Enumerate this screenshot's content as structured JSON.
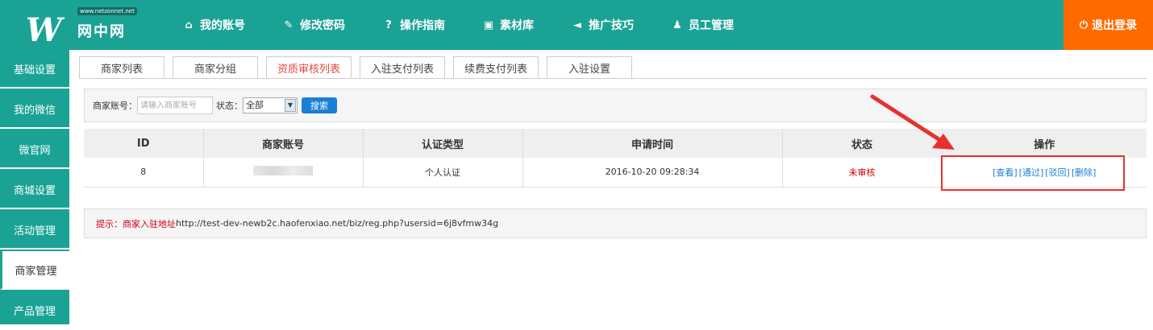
{
  "logo": {
    "url_badge": "www.netzonnet.net",
    "text": "网中网",
    "mark": "W"
  },
  "topnav": [
    {
      "label": "我的账号",
      "icon": "home-icon",
      "glyph": "⌂"
    },
    {
      "label": "修改密码",
      "icon": "edit-icon",
      "glyph": "✎"
    },
    {
      "label": "操作指南",
      "icon": "help-icon",
      "glyph": "?"
    },
    {
      "label": "素材库",
      "icon": "image-icon",
      "glyph": "▣"
    },
    {
      "label": "推广技巧",
      "icon": "megaphone-icon",
      "glyph": "◄"
    },
    {
      "label": "员工管理",
      "icon": "users-icon",
      "glyph": "♟"
    }
  ],
  "logout": {
    "label": "退出登录",
    "icon": "power-icon",
    "glyph": "⏻"
  },
  "sidebar": [
    {
      "label": "基础设置"
    },
    {
      "label": "我的微信"
    },
    {
      "label": "微官网"
    },
    {
      "label": "商城设置"
    },
    {
      "label": "活动管理"
    },
    {
      "label": "商家管理",
      "active": true
    },
    {
      "label": "产品管理"
    }
  ],
  "tabs": [
    {
      "label": "商家列表"
    },
    {
      "label": "商家分组"
    },
    {
      "label": "资质审核列表",
      "active": true
    },
    {
      "label": "入驻支付列表"
    },
    {
      "label": "续费支付列表"
    },
    {
      "label": "入驻设置"
    }
  ],
  "search": {
    "account_label": "商家账号：",
    "account_placeholder": "请输入商家账号",
    "status_label": "状态：",
    "status_value": "全部",
    "button": "搜索"
  },
  "table": {
    "headers": [
      "ID",
      "商家账号",
      "认证类型",
      "申请时间",
      "状态",
      "操作"
    ],
    "rows": [
      {
        "id": "8",
        "account": "",
        "type": "个人认证",
        "time": "2016-10-20 09:28:34",
        "status": "未审核",
        "actions": [
          "[查看]",
          "[通过]",
          "[驳回]",
          "[删除]"
        ]
      }
    ]
  },
  "tip": {
    "label": "提示：商家入驻地址",
    "url": "http://test-dev-newb2c.haofenxiao.net/biz/reg.php?usersid=6j8vfmw34g"
  },
  "colors": {
    "primary": "#1aa394",
    "logout": "#ff6a00",
    "active_tab": "#e04c3c",
    "annotation": "#e8312f"
  }
}
